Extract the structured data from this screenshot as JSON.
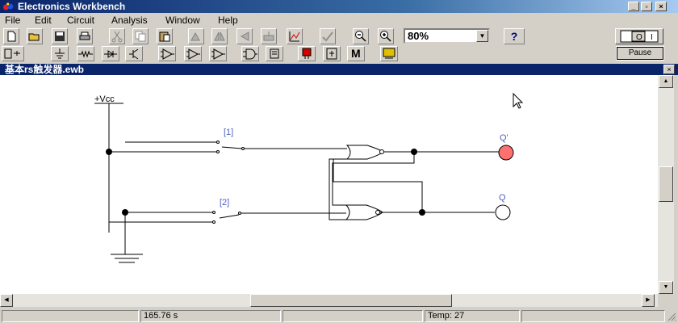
{
  "window": {
    "title": "Electronics Workbench",
    "min_glyph": "_",
    "max_glyph": "▫",
    "close_glyph": "×"
  },
  "menu": [
    {
      "label": "File"
    },
    {
      "label": "Edit"
    },
    {
      "label": "Circuit"
    },
    {
      "label": "Analysis"
    },
    {
      "label": "Window"
    },
    {
      "label": "Help"
    }
  ],
  "toolbar": {
    "zoom_value": "80%",
    "help_label": "?",
    "pause_label": "Pause",
    "power_on_label": "I",
    "power_off_label": "O",
    "bus_label": "M"
  },
  "document": {
    "title": "基本rs触发器.ewb",
    "close_glyph": "×"
  },
  "circuit": {
    "vcc_label": "+Vcc",
    "switch1_label": "[1]",
    "switch2_label": "[2]",
    "output1_label": "Q'",
    "output2_label": "Q",
    "output1_state": "on",
    "output2_state": "off",
    "lamp_on_color": "#ff7070",
    "lamp_off_color": "#ffffff"
  },
  "status": {
    "cell1": "",
    "time": "165.76 s",
    "cell3": "",
    "temp": "Temp:  27",
    "cell5": ""
  }
}
